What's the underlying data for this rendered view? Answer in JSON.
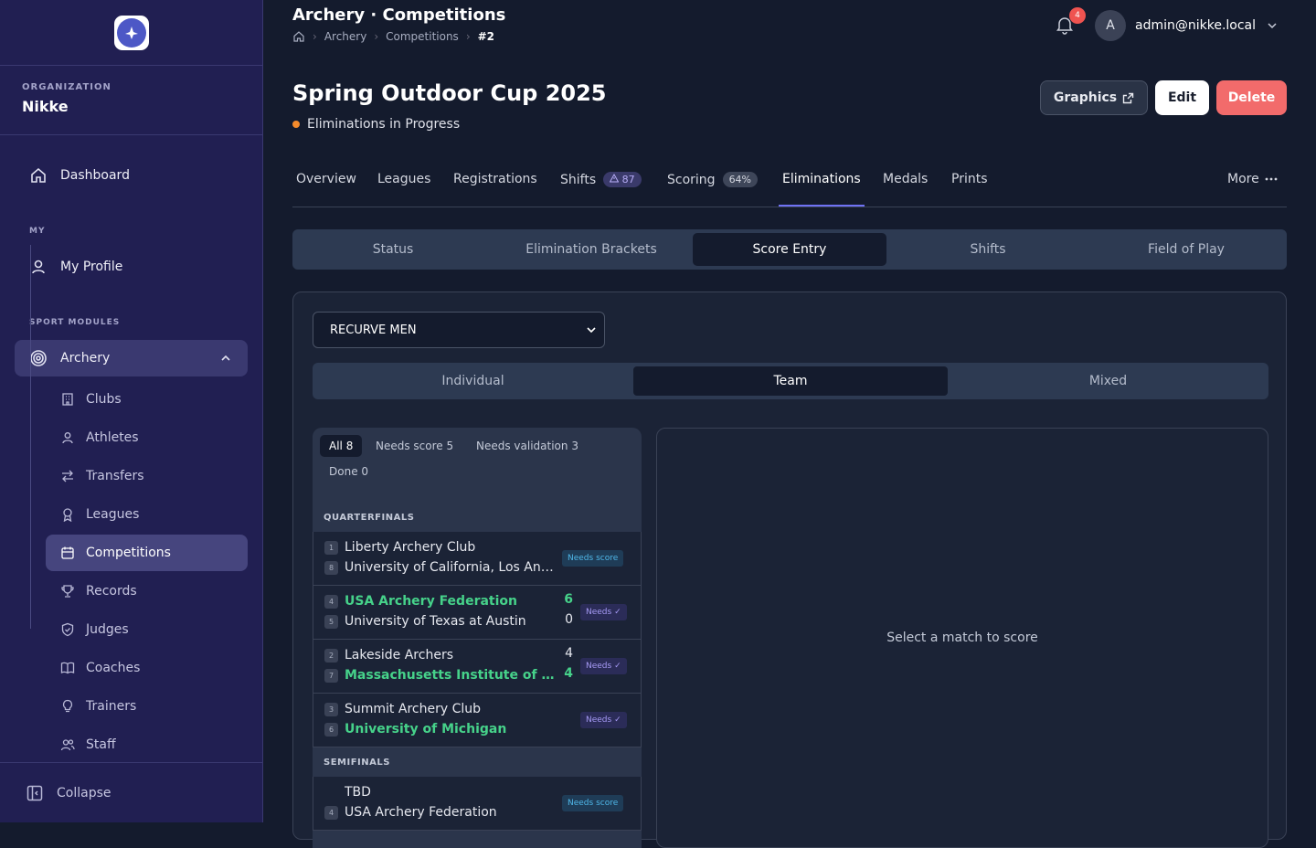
{
  "sidebar": {
    "org_label": "ORGANIZATION",
    "org_name": "Nikke",
    "dashboard": "Dashboard",
    "my_label": "MY",
    "my_profile": "My Profile",
    "sport_label": "SPORT MODULES",
    "archery": "Archery",
    "items": [
      {
        "label": "Clubs",
        "icon": "building-icon"
      },
      {
        "label": "Athletes",
        "icon": "user-icon"
      },
      {
        "label": "Transfers",
        "icon": "transfer-icon"
      },
      {
        "label": "Leagues",
        "icon": "ribbon-icon"
      },
      {
        "label": "Competitions",
        "icon": "calendar-icon"
      },
      {
        "label": "Records",
        "icon": "trophy-icon"
      },
      {
        "label": "Judges",
        "icon": "shield-icon"
      },
      {
        "label": "Coaches",
        "icon": "book-icon"
      },
      {
        "label": "Trainers",
        "icon": "lightbulb-icon"
      },
      {
        "label": "Staff",
        "icon": "users-icon"
      }
    ],
    "active_item": "Competitions",
    "collapse": "Collapse"
  },
  "header": {
    "title": "Archery · Competitions",
    "breadcrumb": [
      "Archery",
      "Competitions",
      "#2"
    ],
    "notifications": "4",
    "avatar_letter": "A",
    "user": "admin@nikke.local"
  },
  "competition": {
    "name": "Spring Outdoor Cup 2025",
    "status": "Eliminations in Progress",
    "status_color": "#f58b2c",
    "graphics_label": "Graphics",
    "edit_label": "Edit",
    "delete_label": "Delete"
  },
  "tabs": {
    "overview": "Overview",
    "leagues": "Leagues",
    "registrations": "Registrations",
    "shifts": "Shifts",
    "shifts_count": "87",
    "scoring": "Scoring",
    "scoring_pct": "64%",
    "eliminations": "Eliminations",
    "medals": "Medals",
    "prints": "Prints",
    "more": "More",
    "active": "Eliminations"
  },
  "subtabs": {
    "status": "Status",
    "brackets": "Elimination Brackets",
    "score_entry": "Score Entry",
    "shifts": "Shifts",
    "field": "Field of Play",
    "active": "Score Entry"
  },
  "score_entry": {
    "division": "RECURVE MEN",
    "segments": {
      "individual": "Individual",
      "team": "Team",
      "mixed": "Mixed",
      "active": "Team"
    },
    "filters": {
      "all": "All",
      "all_count": "8",
      "needs_score": "Needs score",
      "needs_score_count": "5",
      "needs_validation": "Needs validation",
      "needs_validation_count": "3",
      "done": "Done",
      "done_count": "0"
    },
    "rounds": {
      "quarterfinals": "QUARTERFINALS",
      "semifinals": "SEMIFINALS"
    },
    "matches": [
      {
        "a": {
          "seed": "1",
          "name": "Liberty Archery Club",
          "score": "",
          "win": false
        },
        "b": {
          "seed": "8",
          "name": "University of California, Los Angeles",
          "score": "",
          "win": false
        },
        "badge": "Needs score"
      },
      {
        "a": {
          "seed": "4",
          "name": "USA Archery Federation",
          "score": "6",
          "win": true
        },
        "b": {
          "seed": "5",
          "name": "University of Texas at Austin",
          "score": "0",
          "win": false
        },
        "badge": "Needs ✓"
      },
      {
        "a": {
          "seed": "2",
          "name": "Lakeside Archers",
          "score": "4",
          "win": false
        },
        "b": {
          "seed": "7",
          "name": "Massachusetts Institute of Technology",
          "score": "4",
          "win": true
        },
        "badge": "Needs ✓"
      },
      {
        "a": {
          "seed": "3",
          "name": "Summit Archery Club",
          "score": "",
          "win": false
        },
        "b": {
          "seed": "6",
          "name": "University of Michigan",
          "score": "",
          "win": true
        },
        "badge": "Needs ✓"
      },
      {
        "a": {
          "seed": "",
          "name": "TBD",
          "score": "",
          "win": false
        },
        "b": {
          "seed": "4",
          "name": "USA Archery Federation",
          "score": "",
          "win": false
        },
        "badge": "Needs score"
      }
    ],
    "empty_detail": "Select a match to score"
  }
}
